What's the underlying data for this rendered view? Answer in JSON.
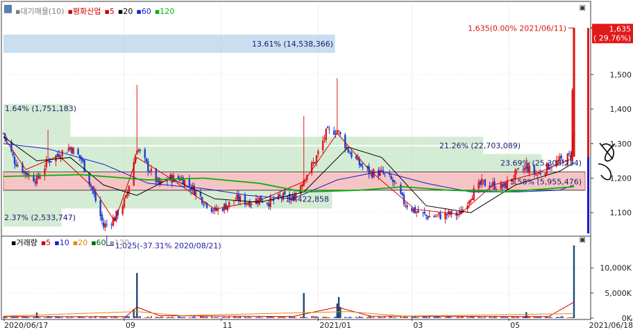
{
  "legend": {
    "app_icon": "chart-icon",
    "item_prefix": "▪",
    "main": [
      {
        "label": "대기매물(10)",
        "color": "#7f7f7f"
      },
      {
        "label": "평화산업",
        "color": "#cc0000"
      },
      {
        "label": "5",
        "color": "#cc0000"
      },
      {
        "label": "20",
        "color": "#000000"
      },
      {
        "label": "60",
        "color": "#1a1acc"
      },
      {
        "label": "120",
        "color": "#00b400"
      }
    ],
    "volume": [
      {
        "label": "거래량",
        "color": "#000000"
      },
      {
        "label": "5",
        "color": "#cc0000"
      },
      {
        "label": "10",
        "color": "#1a1acc"
      },
      {
        "label": "20",
        "color": "#e08a00"
      },
      {
        "label": "60",
        "color": "#006400"
      },
      {
        "label": "120",
        "color": "#9a9a9a"
      }
    ]
  },
  "window_buttons": {
    "price": "▣",
    "volume": "▣"
  },
  "chart_data": [
    {
      "type": "candlestick",
      "title": "평화산업",
      "x_start": "2020/06/17",
      "x_end": "2021/06/18",
      "x_ticks": [
        "2020/06/17",
        "09",
        "11",
        "2021/01",
        "03",
        "05"
      ],
      "y_ticks": [
        1100,
        1200,
        1300,
        1400,
        1500
      ],
      "y_tick_labels": [
        "1,100",
        "1,200",
        "1,300",
        "1,400",
        "1,500"
      ],
      "ylim": [
        1040,
        1700
      ],
      "last_price": 1635,
      "last_price_label": "1,635",
      "last_change_label": "( 29.76%)",
      "price_points": [
        [
          "2020-06-17",
          1330
        ],
        [
          "2020-06-24",
          1250
        ],
        [
          "2020-07-01",
          1215
        ],
        [
          "2020-07-08",
          1195
        ],
        [
          "2020-07-15",
          1250
        ],
        [
          "2020-07-22",
          1270
        ],
        [
          "2020-07-29",
          1290
        ],
        [
          "2020-08-05",
          1255
        ],
        [
          "2020-08-12",
          1165
        ],
        [
          "2020-08-19",
          1060
        ],
        [
          "2020-08-26",
          1085
        ],
        [
          "2020-09-02",
          1140
        ],
        [
          "2020-09-09",
          1290
        ],
        [
          "2020-09-16",
          1230
        ],
        [
          "2020-09-23",
          1180
        ],
        [
          "2020-09-30",
          1200
        ],
        [
          "2020-10-07",
          1200
        ],
        [
          "2020-10-14",
          1170
        ],
        [
          "2020-10-21",
          1135
        ],
        [
          "2020-10-28",
          1105
        ],
        [
          "2020-11-04",
          1120
        ],
        [
          "2020-11-11",
          1140
        ],
        [
          "2020-11-18",
          1130
        ],
        [
          "2020-11-25",
          1140
        ],
        [
          "2020-12-02",
          1130
        ],
        [
          "2020-12-09",
          1145
        ],
        [
          "2020-12-16",
          1140
        ],
        [
          "2020-12-23",
          1200
        ],
        [
          "2020-12-30",
          1250
        ],
        [
          "2021-01-06",
          1330
        ],
        [
          "2021-01-13",
          1340
        ],
        [
          "2021-01-20",
          1280
        ],
        [
          "2021-01-27",
          1240
        ],
        [
          "2021-02-03",
          1215
        ],
        [
          "2021-02-10",
          1215
        ],
        [
          "2021-02-17",
          1190
        ],
        [
          "2021-02-24",
          1130
        ],
        [
          "2021-03-03",
          1105
        ],
        [
          "2021-03-10",
          1090
        ],
        [
          "2021-03-17",
          1090
        ],
        [
          "2021-03-24",
          1095
        ],
        [
          "2021-03-31",
          1095
        ],
        [
          "2021-04-07",
          1150
        ],
        [
          "2021-04-14",
          1185
        ],
        [
          "2021-04-21",
          1180
        ],
        [
          "2021-04-28",
          1175
        ],
        [
          "2021-05-05",
          1210
        ],
        [
          "2021-05-12",
          1230
        ],
        [
          "2021-05-19",
          1210
        ],
        [
          "2021-05-26",
          1235
        ],
        [
          "2021-06-02",
          1250
        ],
        [
          "2021-06-09",
          1265
        ],
        [
          "2021-06-11",
          1635
        ]
      ],
      "peaks": [
        {
          "date": "2020-07-15",
          "high": 1340
        },
        {
          "date": "2020-09-09",
          "high": 1470
        },
        {
          "date": "2020-12-23",
          "high": 1380
        },
        {
          "date": "2021-01-13",
          "high": 1490
        },
        {
          "date": "2021-05-12",
          "high": 1260
        }
      ],
      "moving_averages": [
        {
          "name": "5",
          "color": "#cc0000",
          "points": [
            [
              "2020-06-17",
              1320
            ],
            [
              "2020-07-01",
              1225
            ],
            [
              "2020-07-22",
              1265
            ],
            [
              "2020-08-12",
              1175
            ],
            [
              "2020-08-26",
              1075
            ],
            [
              "2020-09-09",
              1260
            ],
            [
              "2020-09-30",
              1200
            ],
            [
              "2020-10-28",
              1110
            ],
            [
              "2020-11-25",
              1135
            ],
            [
              "2020-12-23",
              1190
            ],
            [
              "2021-01-13",
              1330
            ],
            [
              "2021-02-03",
              1220
            ],
            [
              "2021-03-03",
              1110
            ],
            [
              "2021-03-31",
              1095
            ],
            [
              "2021-04-21",
              1180
            ],
            [
              "2021-05-19",
              1215
            ],
            [
              "2021-06-09",
              1255
            ],
            [
              "2021-06-11",
              1330
            ]
          ]
        },
        {
          "name": "20",
          "color": "#000000",
          "points": [
            [
              "2020-06-17",
              1320
            ],
            [
              "2020-07-08",
              1250
            ],
            [
              "2020-07-29",
              1260
            ],
            [
              "2020-08-19",
              1180
            ],
            [
              "2020-09-09",
              1150
            ],
            [
              "2020-09-30",
              1200
            ],
            [
              "2020-10-28",
              1140
            ],
            [
              "2020-11-25",
              1130
            ],
            [
              "2020-12-23",
              1160
            ],
            [
              "2021-01-20",
              1290
            ],
            [
              "2021-02-10",
              1260
            ],
            [
              "2021-03-10",
              1120
            ],
            [
              "2021-04-07",
              1100
            ],
            [
              "2021-05-05",
              1180
            ],
            [
              "2021-06-02",
              1220
            ],
            [
              "2021-06-11",
              1245
            ]
          ]
        },
        {
          "name": "60",
          "color": "#1a1acc",
          "points": [
            [
              "2020-06-17",
              1300
            ],
            [
              "2020-07-15",
              1285
            ],
            [
              "2020-08-19",
              1240
            ],
            [
              "2020-09-16",
              1185
            ],
            [
              "2020-10-21",
              1170
            ],
            [
              "2020-11-18",
              1150
            ],
            [
              "2020-12-16",
              1140
            ],
            [
              "2021-01-13",
              1195
            ],
            [
              "2021-02-10",
              1220
            ],
            [
              "2021-03-10",
              1185
            ],
            [
              "2021-04-07",
              1160
            ],
            [
              "2021-05-05",
              1160
            ],
            [
              "2021-06-02",
              1165
            ],
            [
              "2021-06-11",
              1180
            ]
          ]
        },
        {
          "name": "120",
          "color": "#00b400",
          "points": [
            [
              "2020-06-17",
              1205
            ],
            [
              "2020-08-05",
              1210
            ],
            [
              "2020-09-16",
              1195
            ],
            [
              "2020-10-21",
              1200
            ],
            [
              "2020-11-25",
              1185
            ],
            [
              "2020-12-23",
              1160
            ],
            [
              "2021-01-27",
              1165
            ],
            [
              "2021-02-24",
              1175
            ],
            [
              "2021-03-24",
              1165
            ],
            [
              "2021-04-28",
              1160
            ],
            [
              "2021-06-11",
              1175
            ]
          ]
        }
      ],
      "supply_bands": [
        {
          "label": "13.61% (14,538,366)",
          "low": 1563,
          "high": 1616
        },
        {
          "label": "1.64% (1,751,183)",
          "low": 1390,
          "high": 1415
        },
        {
          "label": "21.26% (22,703,089)",
          "low": 1270,
          "high": 1320
        },
        {
          "label": "23.69% (25,308,234)",
          "low": 1218,
          "high": 1270
        },
        {
          "label": "5.58% (5,955,476)",
          "low": 1165,
          "high": 1218
        },
        {
          "label": "2.37% (2,533,747)",
          "low": 1060,
          "high": 1112
        }
      ],
      "supply_band_bars": [
        {
          "low": 1563,
          "high": 1616,
          "share": 0.57,
          "color": "#c6dcee"
        },
        {
          "low": 1270,
          "high": 1320,
          "share": 0.825,
          "color": "#d2ebd2"
        },
        {
          "low": 1218,
          "high": 1270,
          "share": 0.925,
          "color": "#d2ebd2"
        },
        {
          "low": 1165,
          "high": 1218,
          "share": 1.0,
          "color": "#f4c2c2"
        },
        {
          "low": 1112,
          "high": 1165,
          "share": 0.565,
          "color": "#d2ebd2"
        },
        {
          "low": 1060,
          "high": 1112,
          "share": 0.1,
          "color": "#d2ebd2"
        },
        {
          "low": 1320,
          "high": 1415,
          "share": 0.115,
          "color": "#d2ebd2"
        }
      ],
      "hidden_band_label": "14,422,858",
      "annotations": [
        {
          "text": "1,635(0.00% 2021/06/11)",
          "date": "2021-06-11",
          "price": 1635
        },
        {
          "text": "1,025(-37.31% 2020/08/21)",
          "date": "2020-08-21",
          "price": 1025
        }
      ]
    },
    {
      "type": "bar",
      "title": "거래량",
      "y_ticks": [
        0,
        5000,
        10000
      ],
      "y_tick_labels": [
        "0K",
        "5,000K",
        "10,000K"
      ],
      "ylim": [
        0,
        15500
      ],
      "spikes": [
        {
          "date": "2020-07-08",
          "value": 1100
        },
        {
          "date": "2020-09-09",
          "value": 9000
        },
        {
          "date": "2020-09-07",
          "value": 1800
        },
        {
          "date": "2020-12-23",
          "value": 5000
        },
        {
          "date": "2021-01-13",
          "value": 2900
        },
        {
          "date": "2021-01-14",
          "value": 4200
        },
        {
          "date": "2021-01-15",
          "value": 2200
        },
        {
          "date": "2021-05-12",
          "value": 1200
        },
        {
          "date": "2021-06-11",
          "value": 14500
        }
      ],
      "base_volume": 250,
      "moving_averages": [
        {
          "name": "5",
          "color": "#cc0000",
          "points": [
            [
              "2020-06-17",
              300
            ],
            [
              "2020-09-02",
              300
            ],
            [
              "2020-09-09",
              2200
            ],
            [
              "2020-09-23",
              500
            ],
            [
              "2020-12-16",
              300
            ],
            [
              "2021-01-13",
              2200
            ],
            [
              "2021-02-03",
              400
            ],
            [
              "2021-05-26",
              300
            ],
            [
              "2021-06-11",
              3200
            ]
          ]
        },
        {
          "name": "20",
          "color": "#e08a00",
          "points": [
            [
              "2020-06-17",
              400
            ],
            [
              "2020-09-09",
              1300
            ],
            [
              "2020-10-07",
              500
            ],
            [
              "2021-01-20",
              1300
            ],
            [
              "2021-02-24",
              400
            ],
            [
              "2021-06-11",
              900
            ]
          ]
        }
      ]
    }
  ],
  "x_labels": [
    "2020/06/17",
    "09",
    "11",
    "2021/01",
    "03",
    "05",
    "2021/06/18"
  ]
}
